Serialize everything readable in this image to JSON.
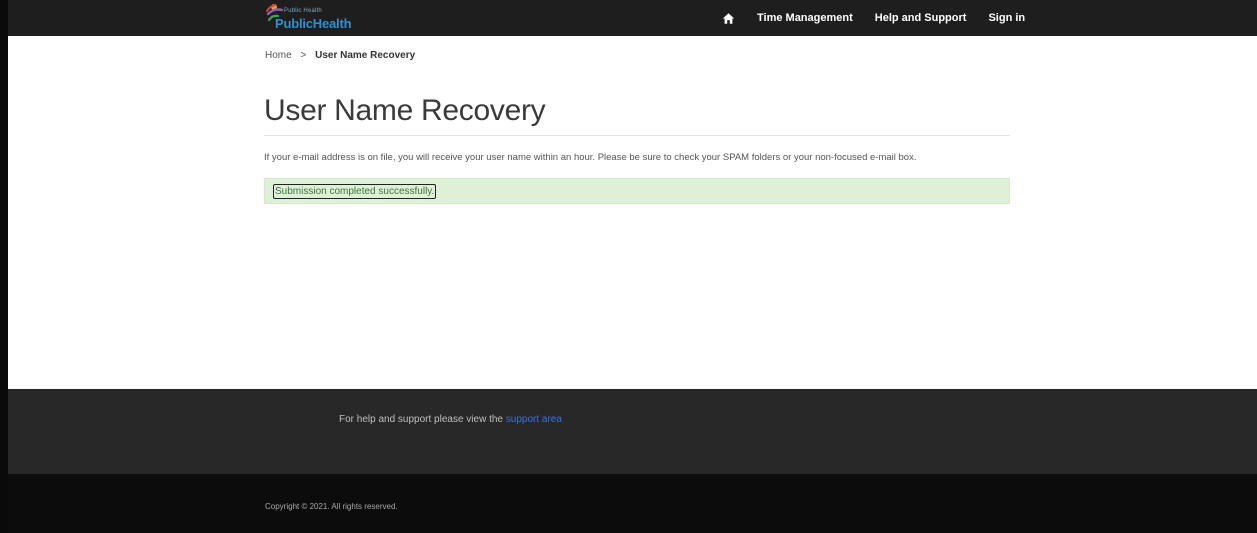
{
  "header": {
    "logo_small": "Public Health",
    "logo_text": "PublicHealth",
    "nav": {
      "time_management": "Time Management",
      "help_and_support": "Help and Support",
      "sign_in": "Sign in"
    }
  },
  "breadcrumb": {
    "home": "Home",
    "separator": ">",
    "current": "User Name Recovery"
  },
  "main": {
    "title": "User Name Recovery",
    "info": "If your e-mail address is on file, you will receive your user name within an hour. Please be sure to check your SPAM folders or your non-focused e-mail box.",
    "alert": "Submission completed successfully."
  },
  "footer": {
    "help_prefix": "For help and support please view the ",
    "help_link": "support area",
    "copyright": "Copyright © 2021. All rights reserved."
  },
  "colors": {
    "topbar": "#1e1e1e",
    "logo_blue": "#2f8fd2",
    "alert_bg": "#dff0d8",
    "alert_text": "#3c763d",
    "link": "#3b6fe0",
    "footer_help": "#282828",
    "footer_copy": "#0c0c0c"
  },
  "icons": {
    "home": "home-icon",
    "logo_mark": "logo-swirl-icon"
  }
}
